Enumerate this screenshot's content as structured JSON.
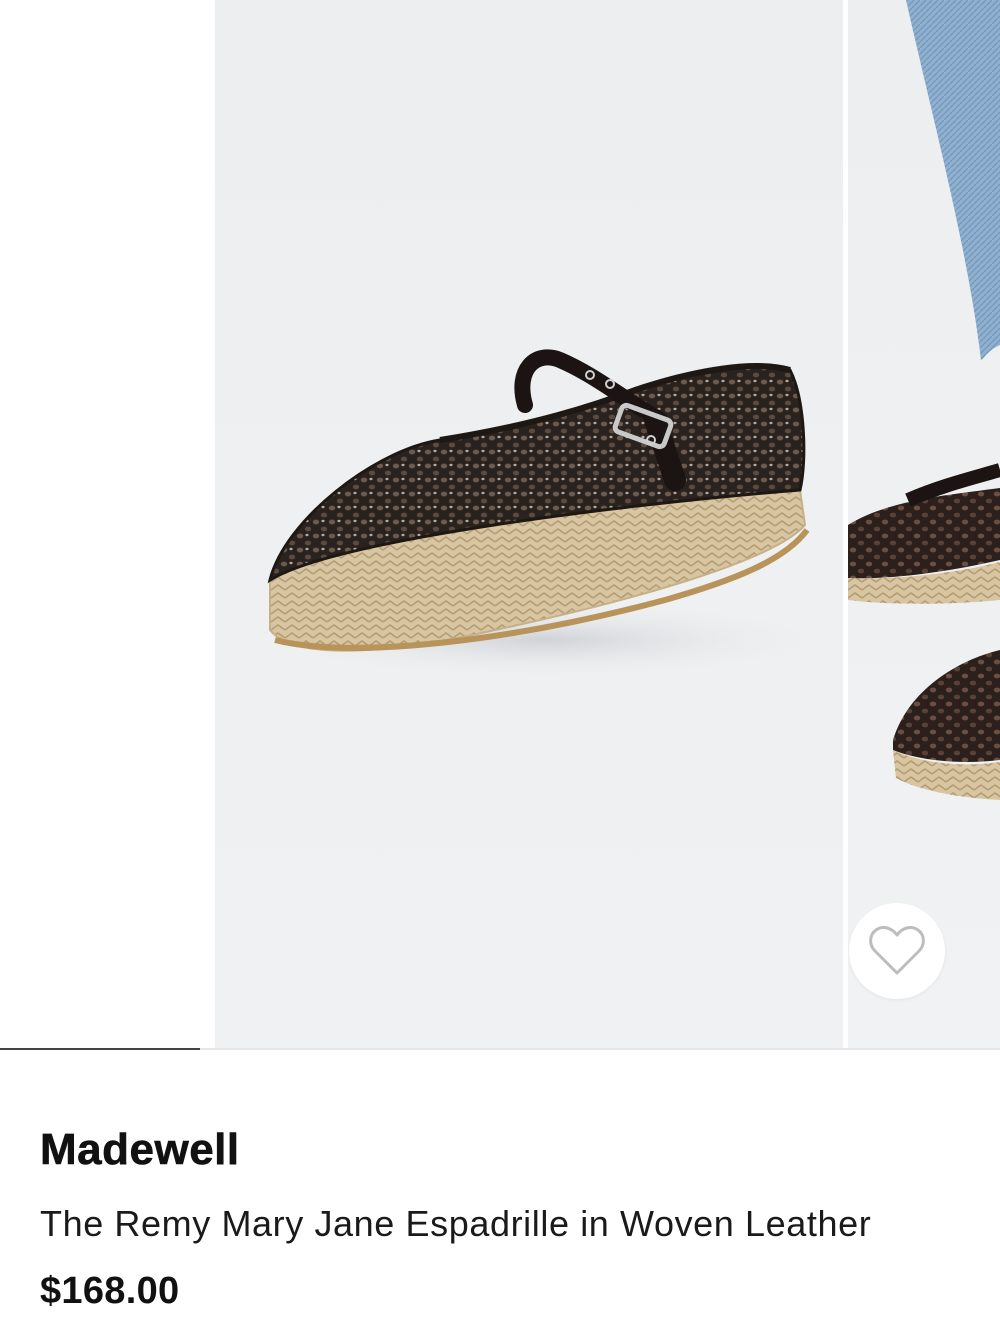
{
  "product": {
    "brand": "Madewell",
    "name": "The Remy Mary Jane Espadrille in Woven Leather",
    "price": "$168.00"
  },
  "gallery": {
    "images": [
      {
        "alt": "shoe-side-view"
      },
      {
        "alt": "shoe-on-model"
      }
    ],
    "progress": 0.2,
    "wishlist_icon": "heart-outline-icon"
  },
  "colors": {
    "leather": "#2b2320",
    "jute": "#d9c6a3",
    "denim": "#8fb0cf",
    "progress": "#444444",
    "background": "#eef0f2"
  }
}
